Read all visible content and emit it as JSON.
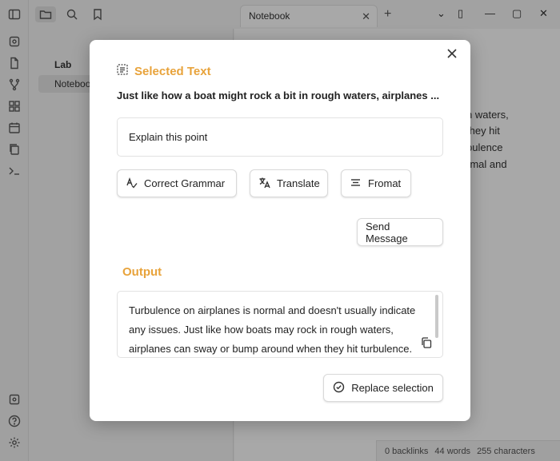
{
  "tab": {
    "title": "Notebook"
  },
  "sidebar": {
    "folder": "Lab",
    "file": "Notebook"
  },
  "editor": {
    "lines": [
      "n waters,",
      "they hit",
      "bulence",
      "rmal and"
    ]
  },
  "statusbar": {
    "backlinks": "0 backlinks",
    "words": "44 words",
    "characters": "255 characters"
  },
  "modal": {
    "selected_title": "Selected Text",
    "selected_text": "Just like how a boat might rock a bit in rough waters, airplanes ...",
    "prompt_value": "Explain this point",
    "actions": {
      "correct_grammar": "Correct Grammar",
      "translate": "Translate",
      "format": "Fromat"
    },
    "send_label": "Send Message",
    "output_title": "Output",
    "output_text": "Turbulence on airplanes is normal and doesn't usually indicate any issues. Just like how boats may rock in rough waters, airplanes can sway or bump around when they hit turbulence.",
    "replace_label": "Replace selection"
  },
  "colors": {
    "accent": "#e8a33b"
  }
}
